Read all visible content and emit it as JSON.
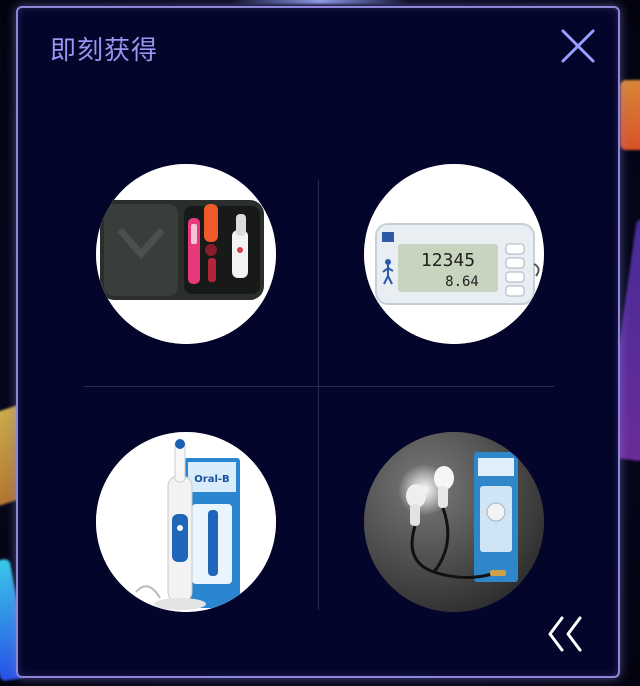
{
  "dialog": {
    "title": "即刻获得"
  },
  "icons": {
    "close": "close-icon",
    "collapse": "double-chevron-left-icon"
  },
  "prizes": [
    {
      "name": "carrying-case-kit",
      "icon": "kit-case-image"
    },
    {
      "name": "pedometer",
      "icon": "pedometer-image",
      "display_main": "12345",
      "display_sub": "8.64"
    },
    {
      "name": "electric-toothbrush",
      "icon": "toothbrush-image",
      "brand": "Oral-B"
    },
    {
      "name": "earphones",
      "icon": "earphones-image"
    }
  ],
  "colors": {
    "panel_border": "#8d86d8",
    "panel_background": "#04052a",
    "title_text": "#9d93f0",
    "close_icon": "#9aa0ff",
    "collapse_icon": "#ffffff"
  }
}
